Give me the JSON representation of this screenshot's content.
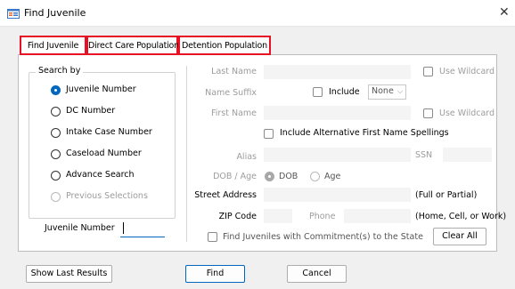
{
  "window": {
    "title": "Find Juvenile",
    "close_glyph": "✕"
  },
  "tabs": [
    {
      "label": "Find Juvenile"
    },
    {
      "label": "Direct Care Population"
    },
    {
      "label": "Detention Population"
    }
  ],
  "search_by": {
    "label": "Search by",
    "options": [
      {
        "label": "Juvenile Number",
        "selected": true,
        "enabled": true
      },
      {
        "label": "DC Number",
        "selected": false,
        "enabled": true
      },
      {
        "label": "Intake Case Number",
        "selected": false,
        "enabled": true
      },
      {
        "label": "Caseload Number",
        "selected": false,
        "enabled": true
      },
      {
        "label": "Advance Search",
        "selected": false,
        "enabled": true
      },
      {
        "label": "Previous Selections",
        "selected": false,
        "enabled": false
      }
    ]
  },
  "juvenile_number": {
    "label": "Juvenile Number",
    "value": ""
  },
  "form": {
    "last_name_label": "Last Name",
    "use_wildcard_label": "Use Wildcard",
    "name_suffix_label": "Name Suffix",
    "include_label": "Include",
    "suffix_value": "None",
    "first_name_label": "First Name",
    "use_wildcard_label_2": "Use Wildcard",
    "alt_first_name_label": "Include Alternative First Name Spellings",
    "alias_label": "Alias",
    "ssn_label": "SSN",
    "dob_age_label": "DOB / Age",
    "dob_option_label": "DOB",
    "age_option_label": "Age",
    "street_label": "Street Address",
    "street_hint": "(Full or Partial)",
    "zip_label": "ZIP Code",
    "phone_label": "Phone",
    "phone_hint": "(Home, Cell, or Work)",
    "commitment_label": "Find Juveniles with Commitment(s) to the State",
    "clear_all_label": "Clear All"
  },
  "footer": {
    "show_last_results_label": "Show Last Results",
    "find_label": "Find",
    "cancel_label": "Cancel"
  },
  "colors": {
    "accent": "#0067c0",
    "tab_highlight": "#e81123",
    "disabled_text": "#9c9c9c"
  },
  "icons": [
    "app-form-icon",
    "close-icon",
    "chevron-down-icon"
  ]
}
